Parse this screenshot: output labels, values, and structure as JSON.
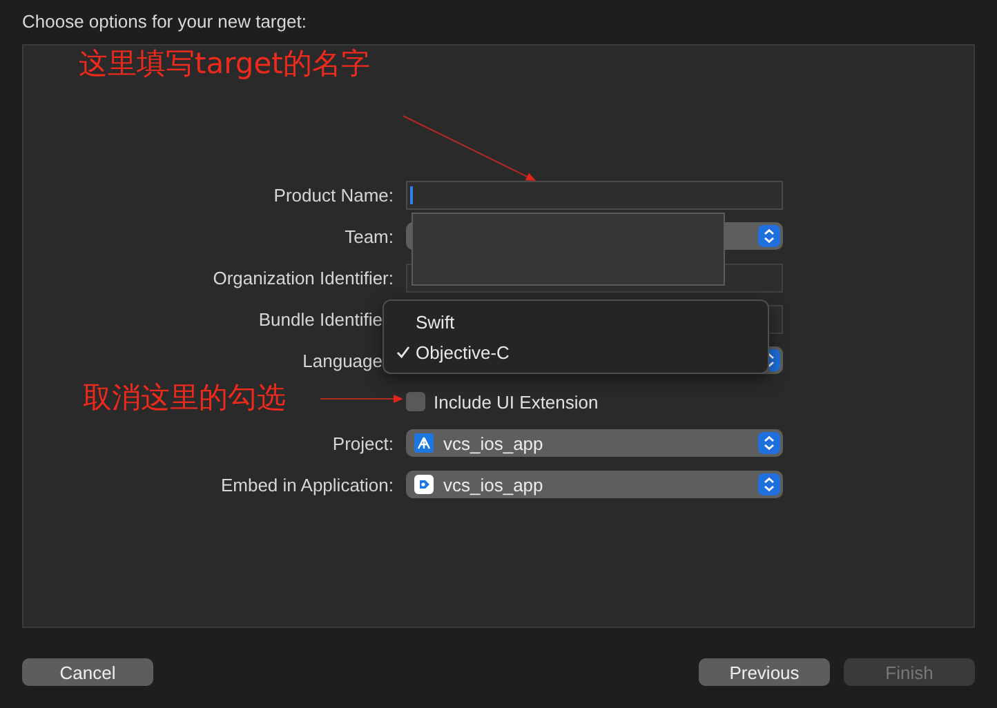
{
  "header": {
    "title": "Choose options for your new target:"
  },
  "form": {
    "rows": [
      {
        "label": "Product Name:",
        "kind": "text",
        "focused": true
      },
      {
        "label": "Team:",
        "kind": "popup"
      },
      {
        "label": "Organization Identifier:",
        "kind": "text"
      },
      {
        "label": "Bundle Identifie",
        "kind": "text",
        "covered": true
      },
      {
        "label": "Language",
        "kind": "popup",
        "covered": true
      },
      {
        "label": "Include UI Extension",
        "kind": "checkbox",
        "checked": false
      },
      {
        "label": "Project:",
        "kind": "project",
        "value": "vcs_ios_app"
      },
      {
        "label": "Embed in Application:",
        "kind": "app",
        "value": "vcs_ios_app"
      }
    ]
  },
  "menu": {
    "items": [
      {
        "label": "Swift",
        "selected": false
      },
      {
        "label": "Objective-C",
        "selected": true
      }
    ]
  },
  "annotations": [
    {
      "text": "这里填写target的名字"
    },
    {
      "text": "取消这里的勾选"
    }
  ],
  "footer": {
    "left": [
      {
        "label": "Cancel",
        "disabled": false
      }
    ],
    "right": [
      {
        "label": "Previous",
        "disabled": false
      },
      {
        "label": "Finish",
        "disabled": true
      }
    ]
  }
}
